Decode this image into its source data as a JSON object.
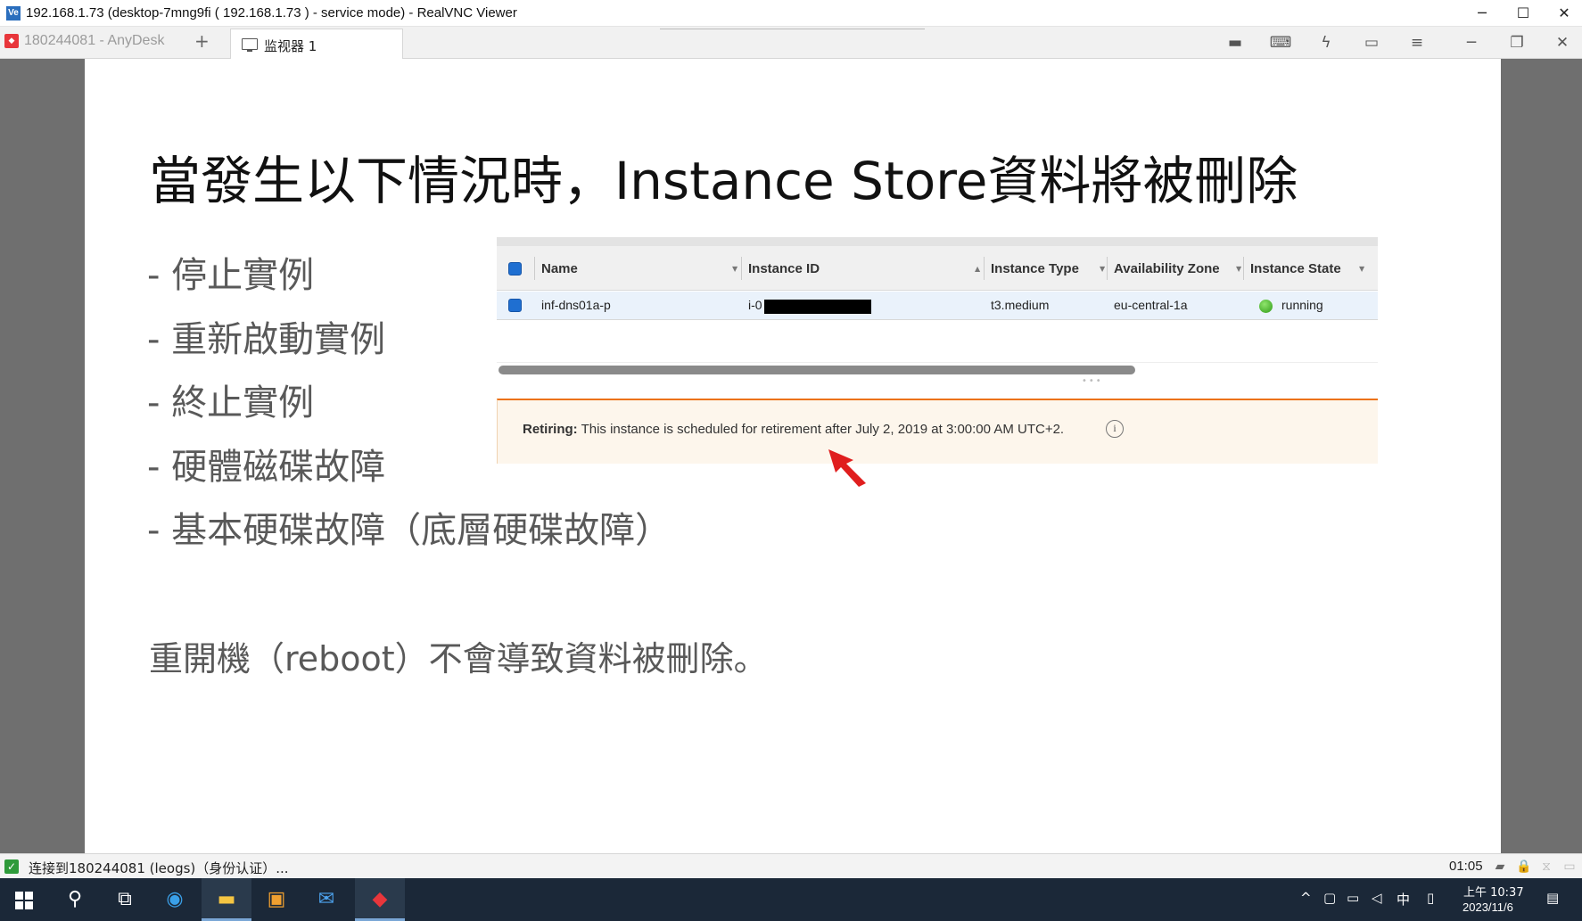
{
  "window": {
    "title": "192.168.1.73 (desktop-7mng9fi ( 192.168.1.73 ) - service mode) - RealVNC Viewer",
    "app_icon": "Ve",
    "minimize": "─",
    "maximize": "☐",
    "close": "✕"
  },
  "tabs": {
    "anydesk_tab": "180244081 - AnyDesk",
    "new_tab": "+",
    "monitor_tab": "监视器 1",
    "tools": [
      "chat-icon",
      "keyboard-icon",
      "action-icon",
      "display-icon",
      "menu-icon"
    ],
    "win_minimize": "─",
    "win_restore": "❐",
    "win_close": "✕"
  },
  "slide": {
    "title": "當發生以下情況時，Instance Store資料將被刪除",
    "bullets": [
      "- 停止實例",
      "- 重新啟動實例",
      "- 終止實例",
      "- 硬體磁碟故障",
      "- 基本硬碟故障（底層硬碟故障）"
    ],
    "note": "重開機（reboot）不會導致資料被刪除。"
  },
  "console": {
    "headers": [
      "Name",
      "Instance ID",
      "Instance Type",
      "Availability Zone",
      "Instance State"
    ],
    "row": {
      "name": "inf-dns01a-p",
      "instance_id": "i-0",
      "instance_type": "t3.medium",
      "availability_zone": "eu-central-1a",
      "state": "running"
    },
    "retiring_label": "Retiring:",
    "retiring_message": " This instance is scheduled for retirement after July 2, 2019 at 3:00:00 AM UTC+2.",
    "info": "i",
    "accent_color": "#ec7211"
  },
  "status": {
    "text": "连接到180244081 (leogs)（身份认证）...",
    "time": "01:05"
  },
  "taskbar": {
    "apps": [
      "start-icon",
      "search-icon",
      "task-view-icon",
      "edge-icon",
      "file-explorer-icon",
      "store-icon",
      "mail-icon",
      "anydesk-icon"
    ],
    "tray_up": "^",
    "tray_ime": "中",
    "clock_time": "上午 10:37",
    "clock_date": "2023/11/6"
  }
}
